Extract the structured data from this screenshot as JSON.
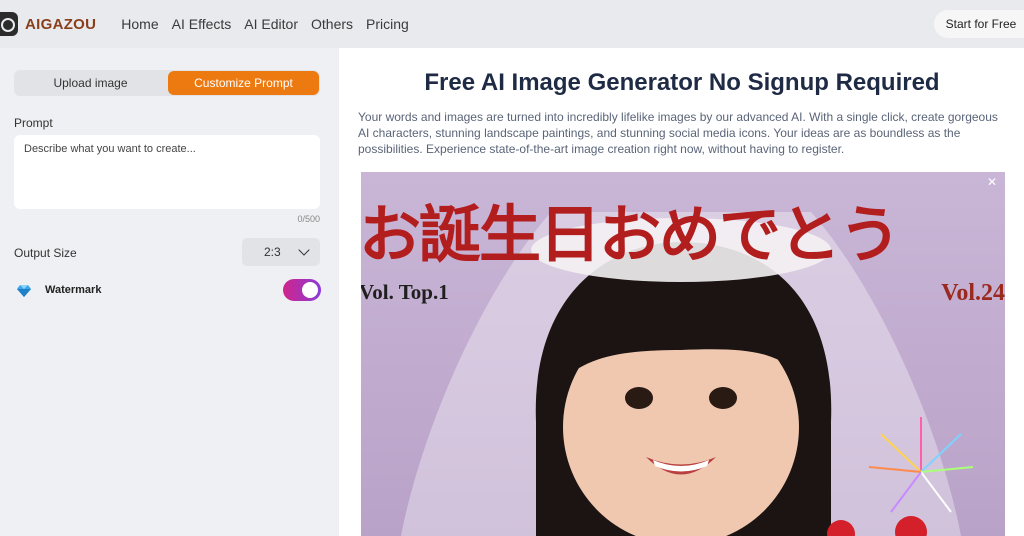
{
  "header": {
    "brand": "AIGAZOU",
    "nav": [
      "Home",
      "AI Effects",
      "AI Editor",
      "Others",
      "Pricing"
    ],
    "cta": "Start for Free"
  },
  "left_panel": {
    "tabs": [
      {
        "label": "Upload image",
        "active": false
      },
      {
        "label": "Customize Prompt",
        "active": true
      }
    ],
    "prompt_label": "Prompt",
    "prompt_placeholder": "Describe what you want to create...",
    "prompt_value": "",
    "counter": "0/500",
    "output_size_label": "Output Size",
    "output_size_value": "2:3",
    "watermark_label": "Watermark",
    "watermark_enabled": true
  },
  "main": {
    "title": "Free AI Image Generator No Signup Required",
    "description": "Your words and images are turned into incredibly lifelike images by our advanced AI. With a single click, create gorgeous AI characters, stunning landscape paintings, and stunning social media icons. Your ideas are as boundless as the possibilities. Experience state-of-the-art image creation right now, without having to register.",
    "image": {
      "headline_jp": "お誕生日おめでとう",
      "vol_left": "Vol. Top.1",
      "vol_right": "Vol.24"
    }
  },
  "colors": {
    "accent": "#ed7a10",
    "brand": "#8a3f1a",
    "title": "#1f2a44",
    "toggle_start": "#d0248a",
    "toggle_end": "#8a3dd8"
  },
  "icons": [
    "logo-icon",
    "gem-icon",
    "chevron-down-icon",
    "close-icon"
  ]
}
